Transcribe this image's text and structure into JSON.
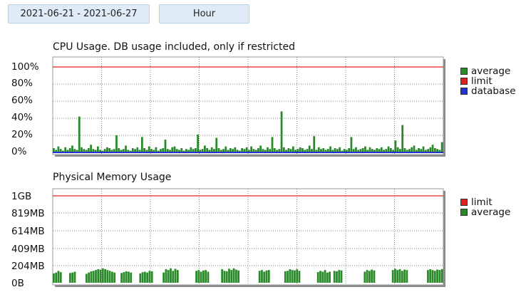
{
  "toolbar": {
    "date_range": "2021-06-21 - 2021-06-27",
    "granularity": "Hour"
  },
  "colors": {
    "average": "#2a8a2a",
    "limit": "#e02020",
    "database": "#2233cc"
  },
  "chart_data": [
    {
      "type": "bar",
      "title": "CPU Usage. DB usage included, only if restricted",
      "ytick_labels": [
        "100%",
        "80%",
        "60%",
        "40%",
        "20%",
        "0%"
      ],
      "ylim": [
        0,
        105
      ],
      "grid": true,
      "legend_position": "right",
      "legend": [
        "average",
        "limit",
        "database"
      ],
      "series": [
        {
          "name": "limit",
          "type": "line",
          "values": [
            100
          ]
        },
        {
          "name": "database",
          "type": "line",
          "values": [
            0
          ]
        },
        {
          "name": "average",
          "type": "bar",
          "length": 168,
          "values": [
            5,
            3,
            7,
            4,
            2,
            6,
            3,
            5,
            8,
            4,
            3,
            42,
            6,
            4,
            3,
            5,
            9,
            4,
            3,
            7,
            3,
            2,
            4,
            6,
            5,
            3,
            4,
            20,
            5,
            3,
            4,
            8,
            3,
            2,
            5,
            4,
            6,
            3,
            18,
            5,
            3,
            7,
            4,
            3,
            6,
            2,
            4,
            5,
            15,
            4,
            3,
            6,
            7,
            4,
            3,
            5,
            2,
            4,
            3,
            6,
            4,
            5,
            21,
            3,
            4,
            8,
            5,
            3,
            6,
            4,
            17,
            5,
            3,
            4,
            7,
            3,
            5,
            4,
            6,
            3,
            2,
            5,
            4,
            6,
            3,
            7,
            4,
            3,
            5,
            8,
            4,
            3,
            6,
            4,
            18,
            5,
            3,
            4,
            48,
            6,
            3,
            5,
            4,
            7,
            3,
            4,
            6,
            5,
            3,
            4,
            8,
            4,
            19,
            3,
            6,
            4,
            5,
            3,
            4,
            7,
            3,
            5,
            4,
            6,
            2,
            4,
            3,
            5,
            18,
            4,
            6,
            3,
            4,
            5,
            7,
            3,
            6,
            4,
            3,
            5,
            4,
            6,
            3,
            4,
            7,
            5,
            3,
            14,
            6,
            4,
            32,
            5,
            3,
            4,
            6,
            8,
            3,
            5,
            4,
            7,
            3,
            4,
            6,
            9,
            5,
            4,
            3,
            12
          ]
        }
      ]
    },
    {
      "type": "bar",
      "title": "Physical Memory Usage",
      "ytick_labels": [
        "1GB",
        "819MB",
        "614MB",
        "409MB",
        "204MB",
        "0B"
      ],
      "ylim_mb": [
        0,
        1075
      ],
      "grid": true,
      "legend_position": "right",
      "legend": [
        "limit",
        "average"
      ],
      "series": [
        {
          "name": "limit",
          "type": "line",
          "values_mb": [
            1024
          ]
        },
        {
          "name": "average",
          "type": "bar",
          "unit": "MB",
          "length": 168,
          "values": [
            110,
            120,
            140,
            125,
            0,
            0,
            0,
            115,
            120,
            130,
            0,
            0,
            0,
            0,
            105,
            120,
            135,
            140,
            150,
            160,
            155,
            170,
            160,
            150,
            140,
            130,
            120,
            0,
            0,
            115,
            125,
            135,
            130,
            120,
            0,
            0,
            0,
            110,
            125,
            130,
            120,
            140,
            135,
            0,
            0,
            0,
            0,
            120,
            160,
            150,
            170,
            140,
            165,
            150,
            0,
            0,
            0,
            0,
            0,
            0,
            0,
            140,
            150,
            130,
            145,
            150,
            130,
            0,
            0,
            0,
            0,
            0,
            160,
            140,
            135,
            165,
            150,
            170,
            155,
            145,
            0,
            0,
            0,
            0,
            0,
            0,
            0,
            0,
            140,
            150,
            130,
            145,
            150,
            0,
            0,
            0,
            0,
            0,
            0,
            135,
            140,
            160,
            150,
            145,
            160,
            140,
            0,
            0,
            0,
            0,
            0,
            0,
            0,
            125,
            140,
            130,
            150,
            120,
            130,
            0,
            140,
            135,
            150,
            145,
            0,
            0,
            0,
            0,
            0,
            0,
            0,
            0,
            0,
            130,
            150,
            140,
            155,
            145,
            0,
            0,
            0,
            0,
            0,
            0,
            0,
            150,
            165,
            150,
            160,
            140,
            155,
            150,
            0,
            0,
            0,
            0,
            0,
            0,
            0,
            0,
            150,
            160,
            150,
            140,
            155,
            150,
            160
          ]
        }
      ]
    }
  ]
}
